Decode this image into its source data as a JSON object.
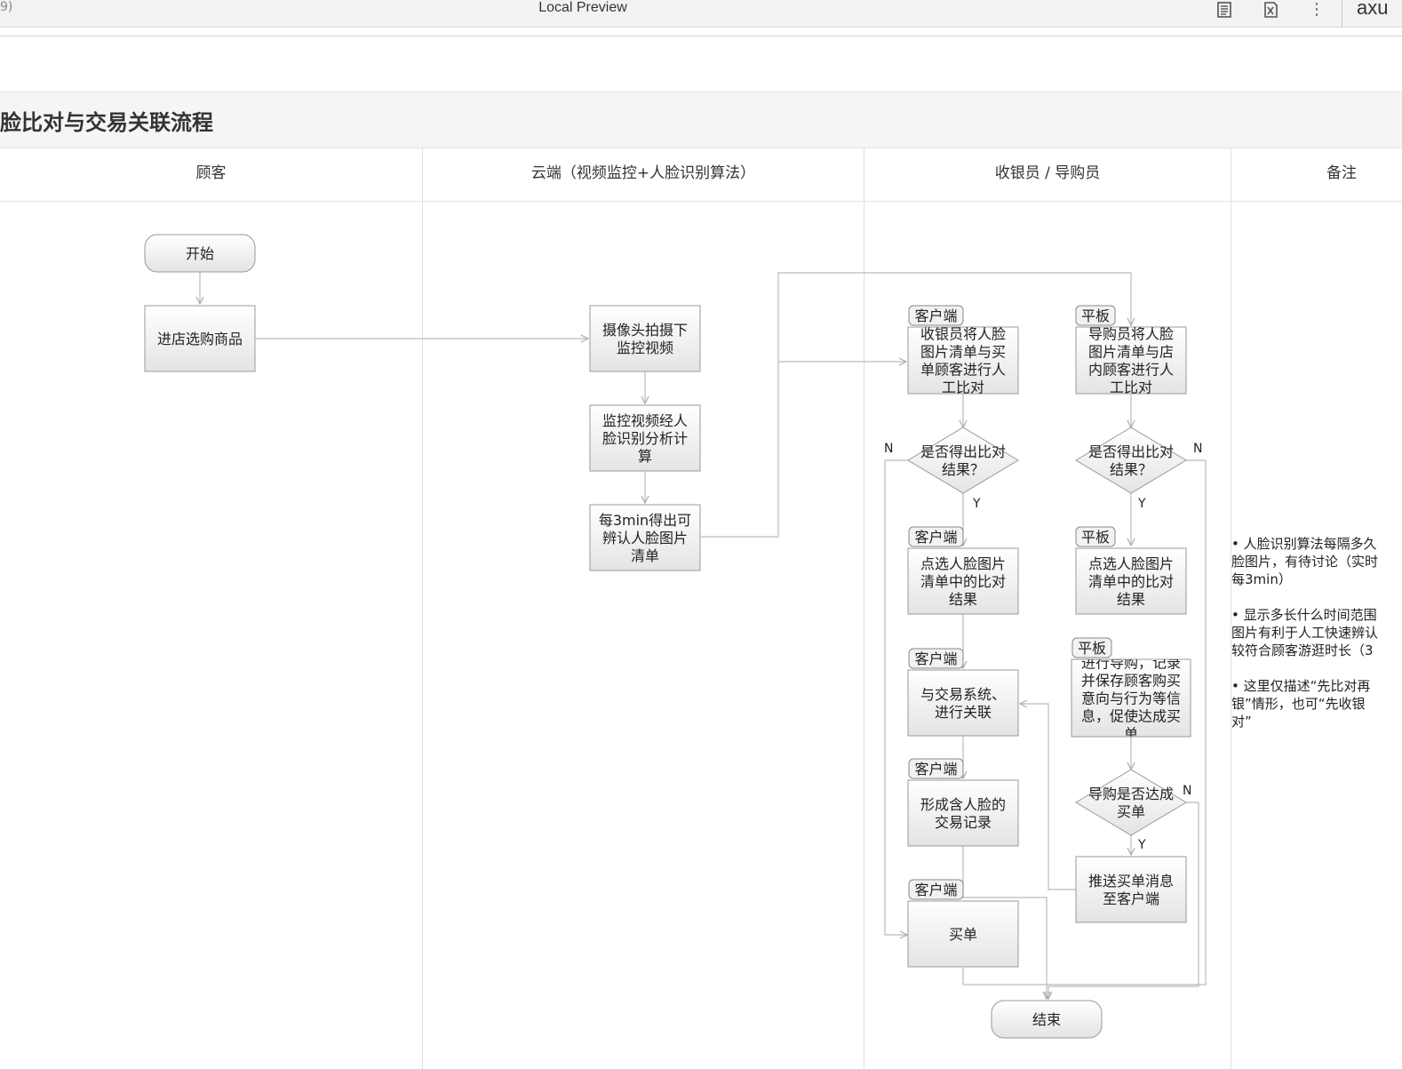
{
  "window": {
    "tab_fragment": "9)",
    "title": "Local Preview",
    "brand": "axu",
    "icons": [
      "document-icon",
      "close-x-icon",
      "more-vertical-icon"
    ]
  },
  "page": {
    "title": "人脸比对与交易关联流程"
  },
  "lanes": [
    "顾客",
    "云端（视频监控+人脸识别算法）",
    "收银员 / 导购员",
    "备注"
  ],
  "diagram": {
    "start": "开始",
    "end": "结束",
    "steps": {
      "enter_store": "进店选购商品",
      "camera": "摄像头拍摄下\n监控视频",
      "analysis": "监控视频经人\n脸识别分析计\n算",
      "list": "每3min得出可\n辨认人脸图片\n清单",
      "cashier_compare": "收银员将人脸\n图片清单与买\n单顾客进行人\n工比对",
      "guide_compare": "导购员将人脸\n图片清单与店\n内顾客进行人\n工比对",
      "decision_cashier": "是否得出比对\n结果？",
      "decision_guide": "是否得出比对\n结果？",
      "select_cashier": "点选人脸图片\n清单中的比对\n结果",
      "select_guide": "点选人脸图片\n清单中的比对\n结果",
      "link_trade": "与交易系统、\n进行关联",
      "guide_record": "进行导购，记录\n并保存顾客购买\n意向与行为等信\n息，促使达成买\n单",
      "form_record": "形成含人脸的\n交易记录",
      "decision_deal": "导购是否达成\n买单",
      "push_msg": "推送买单消息\n至客户端",
      "pay": "买单"
    },
    "tags": {
      "client": "客户端",
      "tablet": "平板"
    },
    "labels": {
      "yes": "Y",
      "no": "N"
    }
  },
  "notes": [
    "• 人脸识别算法每隔多久\n脸图片，有待讨论（实时\n每3min）",
    "• 显示多长什么时间范围\n图片有利于人工快速辨认\n较符合顾客游逛时长（3",
    "• 这里仅描述“先比对再\n银”情形，也可“先收银\n对”"
  ]
}
